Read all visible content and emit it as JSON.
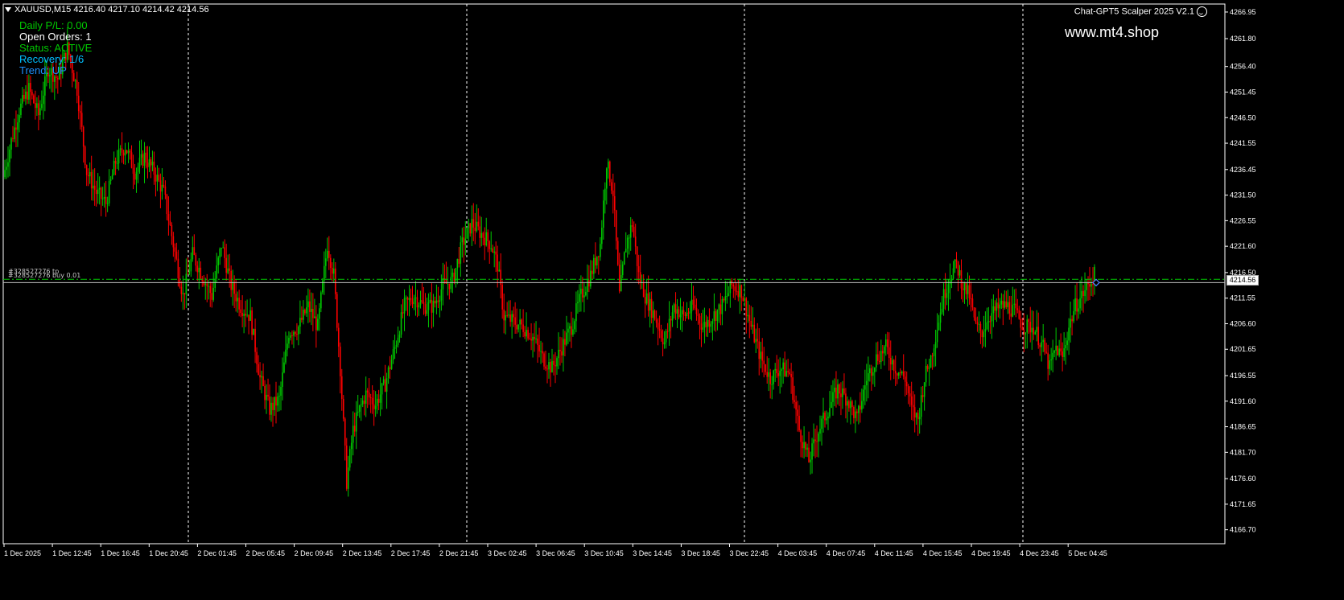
{
  "window": {
    "symbol_header": "XAUUSD,M15  4216.40 4217.10 4214.42 4214.56",
    "ea_name": "Chat-GPT5 Scalper 2025 V2.1"
  },
  "panel": {
    "daily_pl": "Daily P/L: 0.00",
    "open_orders": "Open Orders: 1",
    "status": "Status: ACTIVE",
    "recovery": "Recovery: 1/6",
    "trend": "Trend: UP"
  },
  "watermark": "www.mt4.shop",
  "orders": {
    "label_top": "#328527276 tp",
    "label_bottom": "#328527276 buy 0.01"
  },
  "current_price": "4214.56",
  "colors": {
    "bull": "#00c800",
    "bear": "#ff0000",
    "daily_pl": "#00c800",
    "open_orders": "#ffffff",
    "status": "#00c800",
    "recovery": "#00bfff",
    "trend": "#1e90ff",
    "order_line": "#00c800",
    "bid_line": "#c0c0c0"
  },
  "chart_data": {
    "type": "candlestick",
    "symbol": "XAUUSD",
    "timeframe": "M15",
    "y_ticks": [
      "4266.95",
      "4261.80",
      "4256.40",
      "4251.45",
      "4246.50",
      "4241.55",
      "4236.45",
      "4231.50",
      "4226.55",
      "4221.60",
      "4216.50",
      "4211.55",
      "4206.60",
      "4201.65",
      "4196.55",
      "4191.60",
      "4186.65",
      "4181.70",
      "4176.60",
      "4171.65",
      "4166.70"
    ],
    "x_ticks": [
      "1 Dec 2025",
      "1 Dec 12:45",
      "1 Dec 16:45",
      "1 Dec 20:45",
      "2 Dec 01:45",
      "2 Dec 05:45",
      "2 Dec 09:45",
      "2 Dec 13:45",
      "2 Dec 17:45",
      "2 Dec 21:45",
      "3 Dec 02:45",
      "3 Dec 06:45",
      "3 Dec 10:45",
      "3 Dec 14:45",
      "3 Dec 18:45",
      "3 Dec 22:45",
      "4 Dec 03:45",
      "4 Dec 07:45",
      "4 Dec 11:45",
      "4 Dec 15:45",
      "4 Dec 19:45",
      "4 Dec 23:45",
      "5 Dec 04:45"
    ],
    "ylim": [
      4164.0,
      4268.5
    ],
    "tp_level": 4215.2,
    "bid_level": 4214.56,
    "path_points": [
      [
        0,
        4235
      ],
      [
        5,
        4242
      ],
      [
        10,
        4248
      ],
      [
        16,
        4252
      ],
      [
        22,
        4247
      ],
      [
        28,
        4256
      ],
      [
        34,
        4254
      ],
      [
        40,
        4260
      ],
      [
        46,
        4252
      ],
      [
        52,
        4236
      ],
      [
        58,
        4232
      ],
      [
        64,
        4230
      ],
      [
        70,
        4238
      ],
      [
        76,
        4241
      ],
      [
        82,
        4236
      ],
      [
        88,
        4239
      ],
      [
        94,
        4236
      ],
      [
        100,
        4232
      ],
      [
        106,
        4222
      ],
      [
        112,
        4212
      ],
      [
        118,
        4220
      ],
      [
        124,
        4216
      ],
      [
        130,
        4212
      ],
      [
        136,
        4222
      ],
      [
        142,
        4214
      ],
      [
        148,
        4210
      ],
      [
        154,
        4208
      ],
      [
        160,
        4196
      ],
      [
        166,
        4190
      ],
      [
        172,
        4192
      ],
      [
        178,
        4205
      ],
      [
        184,
        4206
      ],
      [
        190,
        4210
      ],
      [
        196,
        4206
      ],
      [
        202,
        4222
      ],
      [
        206,
        4216
      ],
      [
        210,
        4198
      ],
      [
        214,
        4176
      ],
      [
        218,
        4186
      ],
      [
        222,
        4190
      ],
      [
        226,
        4193
      ],
      [
        232,
        4191
      ],
      [
        238,
        4195
      ],
      [
        244,
        4202
      ],
      [
        250,
        4210
      ],
      [
        256,
        4212
      ],
      [
        262,
        4210
      ],
      [
        268,
        4210
      ],
      [
        274,
        4214
      ],
      [
        280,
        4215
      ],
      [
        286,
        4222
      ],
      [
        292,
        4226
      ],
      [
        298,
        4224
      ],
      [
        304,
        4222
      ],
      [
        308,
        4218
      ],
      [
        312,
        4208
      ],
      [
        318,
        4207
      ],
      [
        324,
        4206
      ],
      [
        330,
        4204
      ],
      [
        336,
        4200
      ],
      [
        342,
        4198
      ],
      [
        348,
        4202
      ],
      [
        354,
        4206
      ],
      [
        360,
        4212
      ],
      [
        366,
        4216
      ],
      [
        372,
        4222
      ],
      [
        376,
        4238
      ],
      [
        380,
        4232
      ],
      [
        384,
        4212
      ],
      [
        388,
        4222
      ],
      [
        392,
        4226
      ],
      [
        396,
        4216
      ],
      [
        400,
        4212
      ],
      [
        406,
        4208
      ],
      [
        412,
        4203
      ],
      [
        418,
        4210
      ],
      [
        424,
        4208
      ],
      [
        430,
        4210
      ],
      [
        436,
        4206
      ],
      [
        442,
        4208
      ],
      [
        448,
        4210
      ],
      [
        454,
        4214
      ],
      [
        460,
        4213
      ],
      [
        466,
        4206
      ],
      [
        472,
        4200
      ],
      [
        478,
        4196
      ],
      [
        484,
        4198
      ],
      [
        490,
        4197
      ],
      [
        496,
        4186
      ],
      [
        502,
        4180
      ],
      [
        508,
        4186
      ],
      [
        514,
        4190
      ],
      [
        520,
        4194
      ],
      [
        526,
        4192
      ],
      [
        532,
        4188
      ],
      [
        538,
        4196
      ],
      [
        544,
        4200
      ],
      [
        550,
        4202
      ],
      [
        556,
        4198
      ],
      [
        562,
        4196
      ],
      [
        566,
        4190
      ],
      [
        570,
        4188
      ],
      [
        574,
        4196
      ],
      [
        578,
        4200
      ],
      [
        582,
        4206
      ],
      [
        586,
        4212
      ],
      [
        590,
        4216
      ],
      [
        594,
        4218
      ],
      [
        598,
        4214
      ],
      [
        602,
        4212
      ],
      [
        606,
        4206
      ],
      [
        610,
        4205
      ],
      [
        614,
        4208
      ],
      [
        618,
        4209
      ],
      [
        622,
        4210
      ],
      [
        626,
        4210
      ],
      [
        630,
        4209
      ],
      [
        636,
        4206
      ],
      [
        642,
        4206
      ],
      [
        648,
        4202
      ],
      [
        652,
        4198
      ],
      [
        656,
        4202
      ],
      [
        660,
        4200
      ],
      [
        664,
        4206
      ],
      [
        668,
        4210
      ],
      [
        672,
        4212
      ],
      [
        676,
        4214
      ],
      [
        680,
        4216
      ]
    ]
  }
}
